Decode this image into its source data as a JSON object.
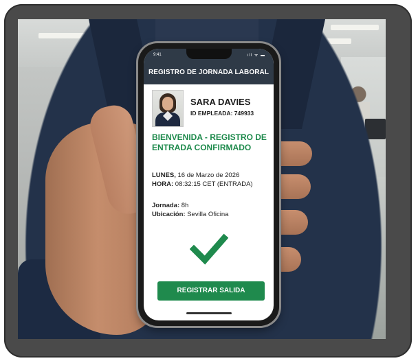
{
  "statusbar": {
    "time": "9:41",
    "icons": "ıll ᯤ ▬"
  },
  "app": {
    "header_title": "REGISTRO DE JORNADA LABORAL"
  },
  "employee": {
    "name": "SARA DAVIES",
    "id_label": "ID EMPLEADA:",
    "id_value": "749933"
  },
  "confirmation": {
    "message_line1": "BIENVENIDA - REGISTRO DE",
    "message_line2": "ENTRADA CONFIRMADO",
    "date_label": "LUNES,",
    "date_value": "16 de Marzo de 2026",
    "time_label": "HORA:",
    "time_value": "08:32:15 CET (ENTRADA)",
    "shift_label": "Jornada:",
    "shift_value": "8h",
    "location_label": "Ubicación:",
    "location_value": "Sevilla Oficina"
  },
  "actions": {
    "checkout_label": "REGISTRAR SALIDA"
  },
  "icons": {
    "success": "check-icon"
  },
  "colors": {
    "accent_green": "#1f8a4d",
    "header_bg": "#2f3a47"
  }
}
